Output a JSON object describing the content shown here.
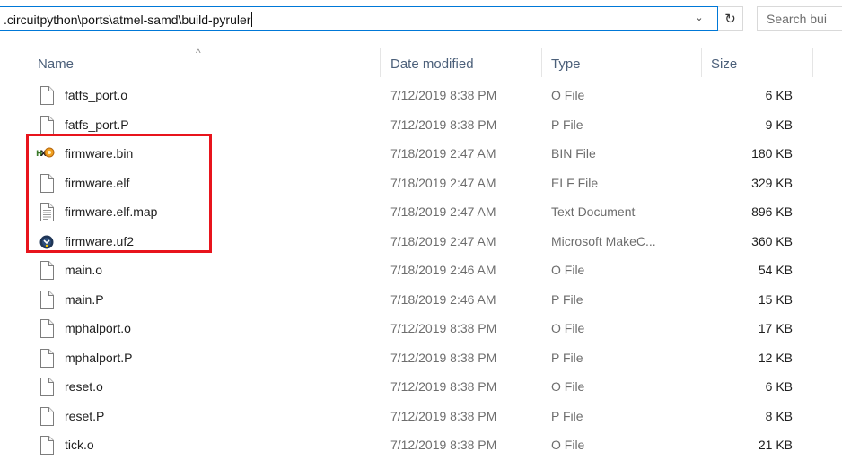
{
  "address_bar": {
    "path": ".circuitpython\\ports\\atmel-samd\\build-pyruler"
  },
  "search": {
    "placeholder": "Search bui"
  },
  "columns": {
    "name": "Name",
    "date": "Date modified",
    "type": "Type",
    "size": "Size"
  },
  "files": [
    {
      "name": "fatfs_port.o",
      "date": "7/12/2019 8:38 PM",
      "type": "O File",
      "size": "6 KB",
      "icon": "blank-file-icon"
    },
    {
      "name": "fatfs_port.P",
      "date": "7/12/2019 8:38 PM",
      "type": "P File",
      "size": "9 KB",
      "icon": "blank-file-icon"
    },
    {
      "name": "firmware.bin",
      "date": "7/18/2019 2:47 AM",
      "type": "BIN File",
      "size": "180 KB",
      "icon": "bin-app-icon"
    },
    {
      "name": "firmware.elf",
      "date": "7/18/2019 2:47 AM",
      "type": "ELF File",
      "size": "329 KB",
      "icon": "blank-file-icon"
    },
    {
      "name": "firmware.elf.map",
      "date": "7/18/2019 2:47 AM",
      "type": "Text Document",
      "size": "896 KB",
      "icon": "text-document-icon"
    },
    {
      "name": "firmware.uf2",
      "date": "7/18/2019 2:47 AM",
      "type": "Microsoft MakeC...",
      "size": "360 KB",
      "icon": "makecode-icon"
    },
    {
      "name": "main.o",
      "date": "7/18/2019 2:46 AM",
      "type": "O File",
      "size": "54 KB",
      "icon": "blank-file-icon"
    },
    {
      "name": "main.P",
      "date": "7/18/2019 2:46 AM",
      "type": "P File",
      "size": "15 KB",
      "icon": "blank-file-icon"
    },
    {
      "name": "mphalport.o",
      "date": "7/12/2019 8:38 PM",
      "type": "O File",
      "size": "17 KB",
      "icon": "blank-file-icon"
    },
    {
      "name": "mphalport.P",
      "date": "7/12/2019 8:38 PM",
      "type": "P File",
      "size": "12 KB",
      "icon": "blank-file-icon"
    },
    {
      "name": "reset.o",
      "date": "7/12/2019 8:38 PM",
      "type": "O File",
      "size": "6 KB",
      "icon": "blank-file-icon"
    },
    {
      "name": "reset.P",
      "date": "7/12/2019 8:38 PM",
      "type": "P File",
      "size": "8 KB",
      "icon": "blank-file-icon"
    },
    {
      "name": "tick.o",
      "date": "7/12/2019 8:38 PM",
      "type": "O File",
      "size": "21 KB",
      "icon": "blank-file-icon"
    }
  ],
  "highlight": {
    "color": "#e8141c"
  }
}
